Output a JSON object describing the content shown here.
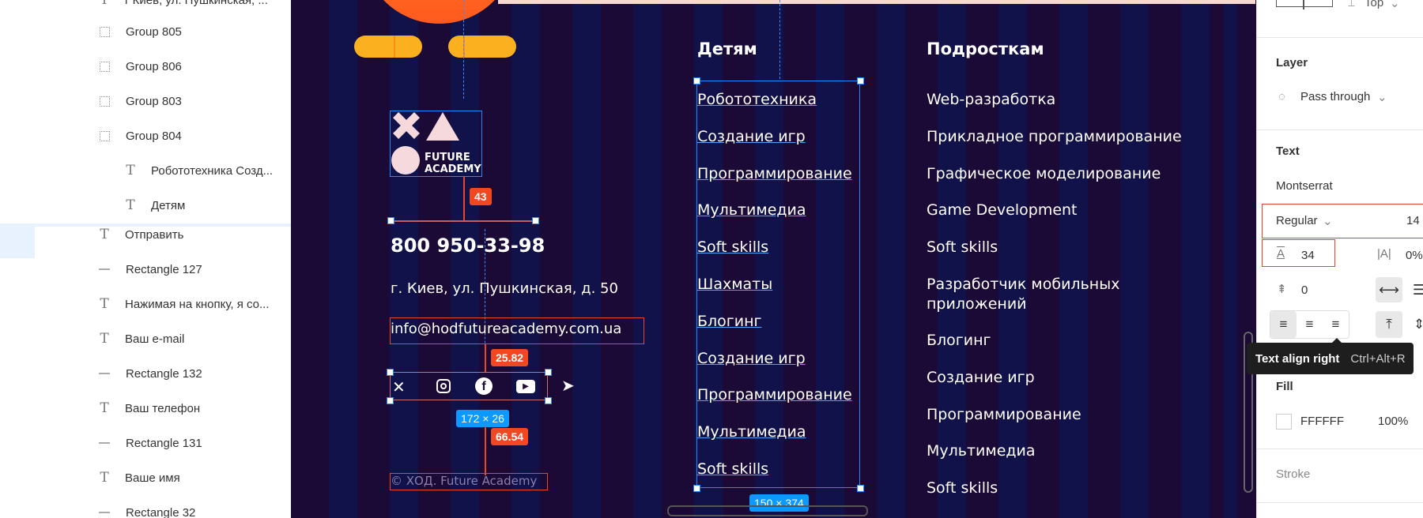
{
  "layers": {
    "items": [
      {
        "label": "г Киев, ул. Пушкинская, ...",
        "type": "text",
        "indent": 1
      },
      {
        "label": "Group 805",
        "type": "group",
        "indent": 1
      },
      {
        "label": "Group 806",
        "type": "group",
        "indent": 1
      },
      {
        "label": "Group 803",
        "type": "group",
        "indent": 1
      },
      {
        "label": "Group 804",
        "type": "group",
        "indent": 1
      },
      {
        "label": "Робототехника Созд...",
        "type": "text",
        "indent": 2
      },
      {
        "label": "Детям",
        "type": "text",
        "indent": 2
      },
      {
        "label": "Отправить",
        "type": "text",
        "indent": 1
      },
      {
        "label": "Rectangle 127",
        "type": "rect",
        "indent": 1
      },
      {
        "label": "Нажимая на кнопку, я со...",
        "type": "text",
        "indent": 1
      },
      {
        "label": "Ваш e-mail",
        "type": "text",
        "indent": 1
      },
      {
        "label": "Rectangle 132",
        "type": "rect",
        "indent": 1
      },
      {
        "label": "Ваш телефон",
        "type": "text",
        "indent": 1
      },
      {
        "label": "Rectangle 131",
        "type": "rect",
        "indent": 1
      },
      {
        "label": "Ваше имя",
        "type": "text",
        "indent": 1
      },
      {
        "label": "Rectangle 32",
        "type": "rect",
        "indent": 1
      }
    ]
  },
  "canvas": {
    "logo_line1": "FUTURE",
    "logo_line2": "ACADEMY",
    "phone": "800 950-33-98",
    "address": "г. Киев, ул. Пушкинская, д. 50",
    "email": "info@hodfutureacademy.com.ua",
    "copyright": "© ХОД. Future Academy",
    "kids_heading": "Детям",
    "kids_items": [
      "Робототехника",
      "Создание игр",
      "Программирование",
      "Мультимедиа",
      "Soft skills",
      "Шахматы",
      "Блогинг",
      "Создание игр",
      "Программирование",
      "Мультимедиа",
      "Soft skills"
    ],
    "teens_heading": "Подросткам",
    "teens_items": [
      "Web-разработка",
      "Прикладное программирование",
      "Графическое моделирование",
      "Game Development",
      "Soft skills",
      "Разработчик мобильных",
      "приложений",
      "Блогинг",
      "Создание игр",
      "Программирование",
      "Мультимедиа",
      "Soft skills"
    ],
    "measure_43": "43",
    "measure_2582": "25.82",
    "measure_6654": "66.54",
    "size_social": "172 × 26",
    "size_list": "150 × 374"
  },
  "props": {
    "top_label": "Top",
    "layer_title": "Layer",
    "blend_mode": "Pass through",
    "text_title": "Text",
    "font_family": "Montserrat",
    "font_weight": "Regular",
    "font_size": "14",
    "line_height": "34",
    "letter_spacing": "0%",
    "paragraph_spacing": "0",
    "fill_title": "Fill",
    "fill_hex": "FFFFFF",
    "fill_opacity": "100%",
    "stroke_title": "Stroke",
    "tooltip_label": "Text align right",
    "tooltip_shortcut": "Ctrl+Alt+R"
  },
  "colors": {
    "canvas_bg": "#1a0a35",
    "stripe": "#0d1550",
    "selection": "#1e8bff",
    "measure_red": "#f24822",
    "accent_orange": "#fbb01f"
  }
}
